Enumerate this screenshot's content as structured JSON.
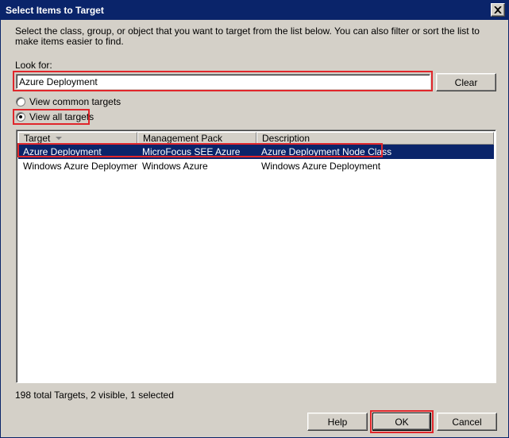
{
  "window": {
    "title": "Select Items to Target",
    "close_icon": "close-icon"
  },
  "instructions": "Select the class, group, or object that you want to target from the list below. You can also filter or sort the list to make items easier to find.",
  "search": {
    "label": "Look for:",
    "value": "Azure Deployment",
    "clear_label": "Clear"
  },
  "filter": {
    "options": [
      {
        "label": "View common targets",
        "checked": false
      },
      {
        "label": "View all targets",
        "checked": true
      }
    ]
  },
  "table": {
    "columns": [
      "Target",
      "Management Pack",
      "Description"
    ],
    "sort_column": "Target",
    "rows": [
      {
        "target": "Azure Deployment",
        "management_pack": "MicroFocus SEE Azure",
        "description": "Azure Deployment Node Class",
        "selected": true
      },
      {
        "target": "Windows Azure Deployment",
        "management_pack": "Windows Azure",
        "description": "Windows Azure Deployment",
        "selected": false
      }
    ]
  },
  "status": "198 total Targets, 2 visible, 1 selected",
  "buttons": {
    "help": "Help",
    "ok": "OK",
    "cancel": "Cancel"
  },
  "colors": {
    "title_bar": "#0a246a",
    "selection": "#0a246a",
    "highlight": "#e0262b",
    "dialog_bg": "#d4d0c8"
  }
}
